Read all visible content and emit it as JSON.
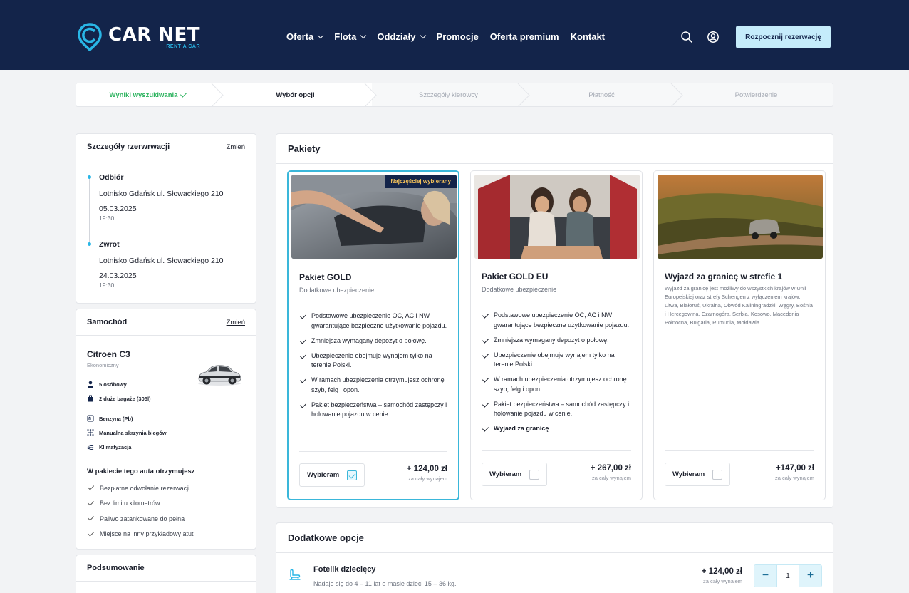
{
  "header": {
    "logo_title": "CAR NET",
    "logo_sub": "RENT A CAR",
    "nav": [
      {
        "label": "Oferta",
        "dropdown": true
      },
      {
        "label": "Flota",
        "dropdown": true
      },
      {
        "label": "Oddziały",
        "dropdown": true
      },
      {
        "label": "Promocje",
        "dropdown": false
      },
      {
        "label": "Oferta premium",
        "dropdown": false
      },
      {
        "label": "Kontakt",
        "dropdown": false
      }
    ],
    "icons": [
      "search-icon",
      "user-icon"
    ],
    "cta_label": "Rozpocznij rezerwację"
  },
  "steps": [
    {
      "label": "Wyniki wyszukiwania",
      "state": "done"
    },
    {
      "label": "Wybór opcji",
      "state": "active"
    },
    {
      "label": "Szczegóły kierowcy",
      "state": "todo"
    },
    {
      "label": "Płatność",
      "state": "todo"
    },
    {
      "label": "Potwierdzenie",
      "state": "todo"
    }
  ],
  "reservation": {
    "title": "Szczegóły rzerwrwacji",
    "change_label": "Zmień",
    "pickup": {
      "label": "Odbiór",
      "address": "Lotnisko Gdańsk ul. Słowackiego 210",
      "date": "05.03.2025",
      "time": "19:30"
    },
    "return": {
      "label": "Zwrot",
      "address": "Lotnisko Gdańsk ul. Słowackiego 210",
      "date": "24.03.2025",
      "time": "19:30"
    }
  },
  "car": {
    "title": "Samochód",
    "change_label": "Zmień",
    "name": "Citroen C3",
    "class": "Ekonomiczny",
    "specs": [
      {
        "icon": "person-icon",
        "label": "5 osóbowy"
      },
      {
        "icon": "luggage-icon",
        "label": "2 duże bagaże (305l)"
      },
      {
        "icon": "fuel-icon",
        "label": "Benzyna (Pb)"
      },
      {
        "icon": "gearbox-icon",
        "label": "Manualna skrzynia biegów"
      },
      {
        "icon": "aircon-icon",
        "label": "Klimatyzacja"
      }
    ],
    "included_title": "W pakiecie tego auta otrzymujesz",
    "included": [
      "Bezpłatne odwołanie rezerwacji",
      "Bez limitu kilometrów",
      "Paliwo zatankowane do pełna",
      "Miejsce na inny przykładowy atut"
    ]
  },
  "summary": {
    "title": "Podsumowanie"
  },
  "packages": {
    "title": "Pakiety",
    "choose_label": "Wybieram",
    "price_note": "za cały wynajem",
    "items": [
      {
        "title": "Pakiet GOLD",
        "subtitle": "Dodatkowe ubezpieczenie",
        "badge": "Najczęściej wybierany",
        "selected": true,
        "price": "+ 124,00 zł",
        "features": [
          {
            "text": "Podstawowe ubezpieczenie OC, AC i NW gwarantujące bezpieczne użytkowanie pojazdu.",
            "bold": false
          },
          {
            "text": "Zmniejsza wymagany depozyt o połowę.",
            "bold": false
          },
          {
            "text": "Ubezpieczenie obejmuje wynajem tylko na terenie Polski.",
            "bold": false
          },
          {
            "text": "W ramach ubezpieczenia otrzymujesz ochronę szyb, felg i opon.",
            "bold": false
          },
          {
            "text": "Pakiet bezpieczeństwa – samochód zastępczy i holowanie pojazdu w cenie.",
            "bold": false
          }
        ]
      },
      {
        "title": "Pakiet GOLD EU",
        "subtitle": "Dodatkowe ubezpieczenie",
        "selected": false,
        "price": "+ 267,00 zł",
        "features": [
          {
            "text": "Podstawowe ubezpieczenie OC, AC i NW gwarantujące bezpieczne użytkowanie pojazdu.",
            "bold": false
          },
          {
            "text": "Zmniejsza wymagany depozyt o połowę.",
            "bold": false
          },
          {
            "text": "Ubezpieczenie obejmuje wynajem tylko na terenie Polski.",
            "bold": false
          },
          {
            "text": "W ramach ubezpieczenia otrzymujesz ochronę szyb, felg i opon.",
            "bold": false
          },
          {
            "text": "Pakiet bezpieczeństwa – samochód zastępczy i holowanie pojazdu w cenie.",
            "bold": false
          },
          {
            "text": "Wyjazd za granicę",
            "bold": true
          }
        ]
      },
      {
        "title": "Wyjazd za granicę w strefie 1",
        "description": "Wyjazd za granicę jest możliwy do wszystkich krajów w Unii Europejskiej oraz strefy Schengen z wyłączeniem krajów: Litwa, Białoruś, Ukraina, Obwód Kaliningradzki, Węgry, Bośnia i Hercegowina, Czarnogóra, Serbia, Kosowo, Macedonia Północna, Bułgaria, Rumunia, Mołdawia.",
        "selected": false,
        "price": "+147,00 zł",
        "features": []
      }
    ]
  },
  "extras": {
    "title": "Dodatkowe opcje",
    "items": [
      {
        "icon": "child-seat-icon",
        "name": "Fotelik dziecięcy",
        "desc": "Nadaje się do 4 – 11 lat o masie dzieci 15 – 36 kg.",
        "price": "+ 124,00 zł",
        "price_note": "za cały wynajem",
        "quantity": "1",
        "minus": "−",
        "plus": "+"
      }
    ]
  },
  "colors": {
    "navy": "#13244a",
    "accent": "#29b6e6",
    "success": "#2db35f",
    "badge_text": "#f7c45a"
  }
}
